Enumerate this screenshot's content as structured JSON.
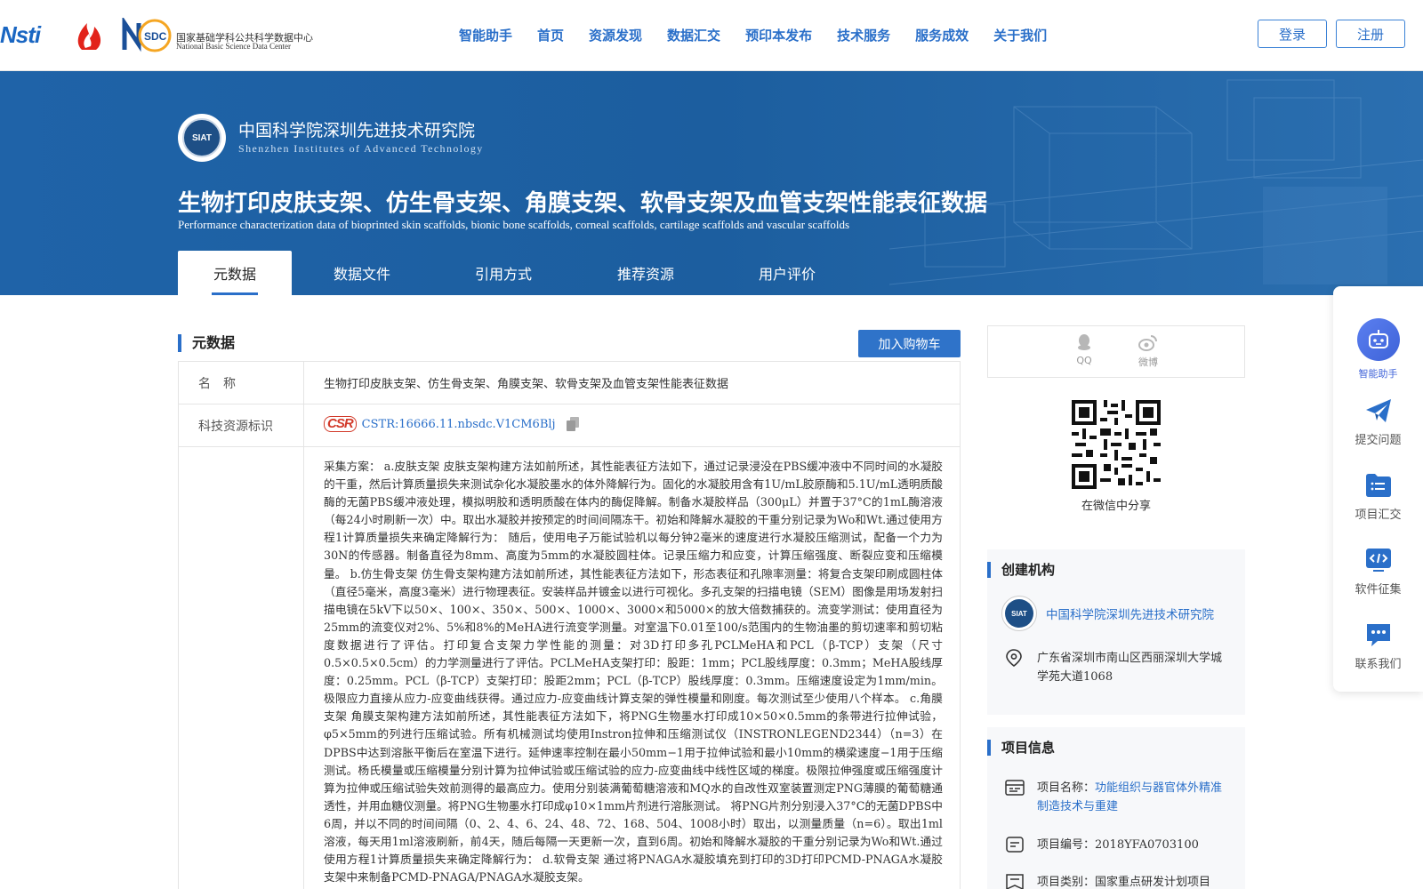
{
  "header": {
    "logo_cstr_text": "Nsti",
    "nsdc_mark_text": "SDC",
    "nsdc_cn": "国家基础学科公共科学数据中心",
    "nsdc_en": "National Basic Science Data Center",
    "nav": [
      "智能助手",
      "首页",
      "资源发现",
      "数据汇交",
      "预印本发布",
      "技术服务",
      "服务成效",
      "关于我们"
    ],
    "login": "登录",
    "register": "注册"
  },
  "banner": {
    "inst_logo_text": "SIAT",
    "inst_cn": "中国科学院深圳先进技术研究院",
    "inst_en": "Shenzhen Institutes of Advanced Technology",
    "title_cn": "生物打印皮肤支架、仿生骨支架、角膜支架、软骨支架及血管支架性能表征数据",
    "title_en": "Performance characterization data of bioprinted skin scaffolds, bionic bone scaffolds, corneal scaffolds, cartilage scaffolds and vascular scaffolds",
    "tabs": [
      "元数据",
      "数据文件",
      "引用方式",
      "推荐资源",
      "用户评价"
    ]
  },
  "metadata": {
    "section_title": "元数据",
    "add_cart": "加入购物车",
    "name_label": "名　称",
    "name_value": "生物打印皮肤支架、仿生骨支架、角膜支架、软骨支架及血管支架性能表征数据",
    "id_label": "科技资源标识",
    "cstr_badge": "CSR",
    "cstr_value": "CSTR:16666.11.nbsdc.V1CM6Blj",
    "long_text": "采集方案： a.皮肤支架 皮肤支架构建方法如前所述，其性能表征方法如下，通过记录浸没在PBS缓冲液中不同时间的水凝胶的干重，然后计算质量损失来测试杂化水凝胶墨水的体外降解行为。固化的水凝胶用含有1U/mL胶原酶和5.1U/mL透明质酸酶的无菌PBS缓冲液处理，模拟明胶和透明质酸在体内的酶促降解。制备水凝胶样品（300μL）并置于37°C的1mL酶溶液（每24小时刷新一次）中。取出水凝胶并按预定的时间间隔冻干。初始和降解水凝胶的干重分别记录为Wo和Wt.通过使用方程1计算质量损失来确定降解行为： 随后，使用电子万能试验机以每分钟2毫米的速度进行水凝胶压缩测试，配备一个力为30N的传感器。制备直径为8mm、高度为5mm的水凝胶圆柱体。记录压缩力和应变，计算压缩强度、断裂应变和压缩模量。 b.仿生骨支架 仿生骨支架构建方法如前所述，其性能表征方法如下，形态表征和孔隙率测量：将复合支架印刷成圆柱体（直径5毫米，高度3毫米）进行物理表征。安装样品并镀金以进行可视化。多孔支架的扫描电镜（SEM）图像是用场发射扫描电镜在5kV下以50×、100×、350×、500×、1000×、3000×和5000×的放大倍数捕获的。流变学测试：使用直径为25mm的流变仪对2%、5%和8%的MeHA进行流变学测量。对室温下0.01至100/s范围内的生物油墨的剪切速率和剪切粘度数据进行了评估。打印复合支架力学性能的测量：对3D打印多孔PCLMeHA和PCL（β-TCP）支架（尺寸0.5×0.5×0.5cm）的力学测量进行了评估。PCLMeHA支架打印：股距：1mm；PCL股线厚度：0.3mm；MeHA股线厚度：0.25mm。PCL（β-TCP）支架打印：股距2mm；PCL（β-TCP）股线厚度：0.3mm。压缩速度设定为1mm/min。极限应力直接从应力-应变曲线获得。通过应力-应变曲线计算支架的弹性模量和刚度。每次测试至少使用八个样本。 c.角膜支架 角膜支架构建方法如前所述，其性能表征方法如下，将PNG生物墨水打印成10×50×0.5mm的条带进行拉伸试验，φ5×5mm的列进行压缩试验。所有机械测试均使用Instron拉伸和压缩测试仪（INSTRONLEGEND2344）（n=3）在DPBS中达到溶胀平衡后在室温下进行。延伸速率控制在最小50mm−1用于拉伸试验和最小10mm的横梁速度−1用于压缩测试。杨氏模量或压缩模量分别计算为拉伸试验或压缩试验的应力-应变曲线中线性区域的梯度。极限拉伸强度或压缩强度计算为拉伸或压缩试验失效前测得的最高应力。使用分别装满葡萄糖溶液和MQ水的自改性双室装置测定PNG薄膜的葡萄糖通透性，并用血糖仪测量。将PNG生物墨水打印成φ10×1mm片剂进行溶胀测试。 将PNG片剂分别浸入37°C的无菌DPBS中6周，并以不同的时间间隔（0、2、4、6、24、48、72、168、504、1008小时）取出，以测量质量（n=6）。取出1ml溶液，每天用1ml溶液刷新，前4天，随后每隔一天更新一次，直到6周。初始和降解水凝胶的干重分别记录为Wo和Wt.通过使用方程1计算质量损失来确定降解行为： d.软骨支架 通过将PNAGA水凝胶填充到打印的3D打印PCMD-PNAGA水凝胶支架中来制备PCMD-PNAGA/PNAGA水凝胶支架。"
  },
  "share": {
    "qq": "QQ",
    "weibo": "微博",
    "wechat_caption": "在微信中分享"
  },
  "creator": {
    "title": "创建机构",
    "logo_text": "SIAT",
    "name": "中国科学院深圳先进技术研究院",
    "address": "广东省深圳市南山区西丽深圳大学城学苑大道1068"
  },
  "project": {
    "title": "项目信息",
    "name_label": "项目名称：",
    "name_value": "功能组织与器官体外精准制造技术与重建",
    "code_label": "项目编号：",
    "code_value": "2018YFA0703100",
    "type_label": "项目类别：",
    "type_value": "国家重点研发计划项目"
  },
  "float_bar": {
    "ai": "智能助手",
    "submit": "提交问题",
    "project": "项目汇交",
    "software": "软件征集",
    "contact": "联系我们"
  },
  "colors": {
    "accent": "#2a6fc9",
    "banner": "#1f63a8"
  }
}
